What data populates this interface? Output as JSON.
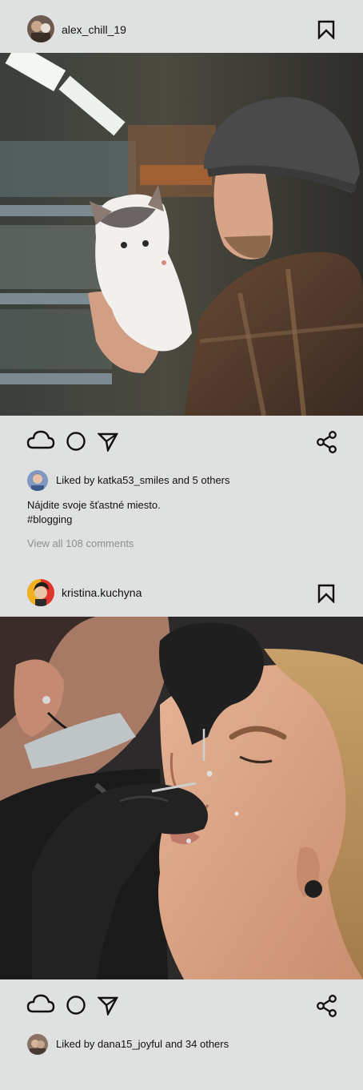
{
  "posts": [
    {
      "username": "alex_chill_19",
      "likes_text": "Liked by katka53_smiles and 5 others",
      "caption_line1": "Nájdite svoje šťastné miesto.",
      "caption_line2": "#blogging",
      "comments_link": "View all 108 comments",
      "icons": [
        "bookmark-icon",
        "cloud-icon",
        "circle-icon",
        "send-icon",
        "share-icon"
      ]
    },
    {
      "username": "kristina.kuchyna",
      "likes_text": "Liked by dana15_joyful and 34 others",
      "icons": [
        "bookmark-icon",
        "cloud-icon",
        "circle-icon",
        "send-icon",
        "share-icon"
      ]
    }
  ],
  "colors": {
    "background": "#dfe1e0",
    "text": "#111111",
    "muted": "#8d8f8e"
  }
}
